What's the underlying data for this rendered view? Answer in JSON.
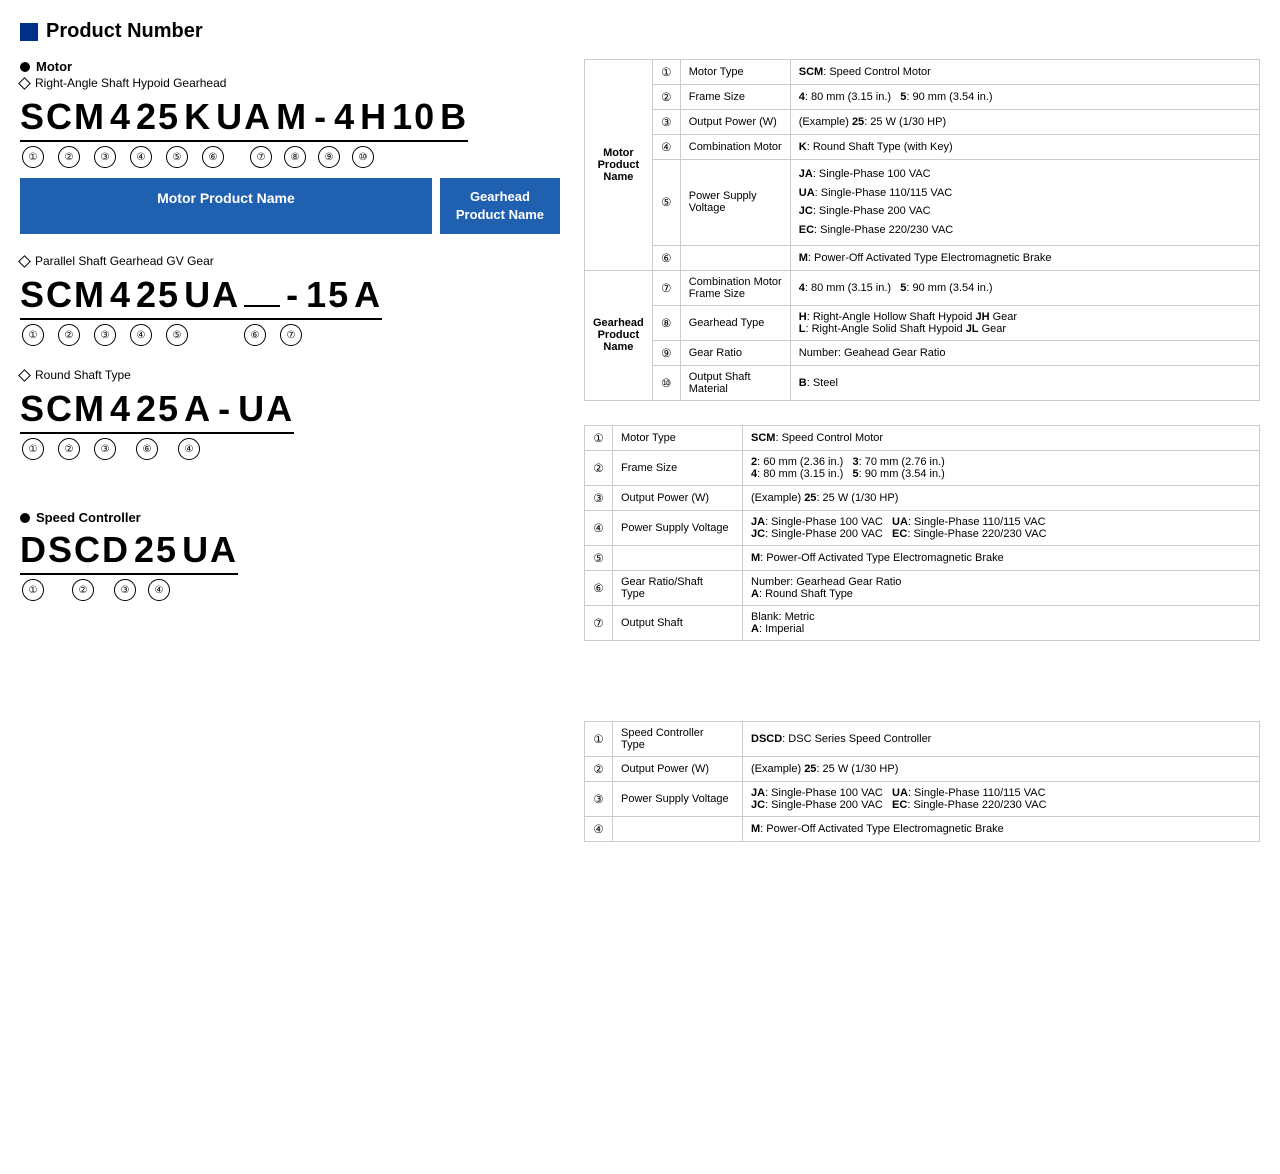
{
  "page": {
    "title": "Product Number",
    "sections": {
      "motor_label": "Motor",
      "right_angle_label": "Right-Angle Shaft Hypoid Gearhead",
      "parallel_label": "Parallel Shaft Gearhead GV Gear",
      "round_shaft_label": "Round Shaft Type",
      "speed_controller_label": "Speed Controller"
    },
    "codes": {
      "hypoid": "SCM 4 25 K UA M - 4 H 10 B",
      "parallel": "SCM 4 25 UA  - 15 A",
      "round_shaft": "SCM 4 25 A - UA"
    },
    "boxes": {
      "motor_product_name": "Motor Product Name",
      "gearhead_product_name": "Gearhead\nProduct Name"
    },
    "speed_controller": {
      "code": "DSCD 25 UA",
      "label1": "①",
      "label2": "②",
      "label3": "③",
      "label4": "④"
    }
  },
  "table1": {
    "group_motor": "Motor\nProduct\nName",
    "group_gearhead": "Gearhead\nProduct\nName",
    "rows": [
      {
        "num": "①",
        "label": "Motor Type",
        "desc": "SCM: Speed Control Motor",
        "bold_parts": [
          "SCM"
        ]
      },
      {
        "num": "②",
        "label": "Frame Size",
        "desc": "4: 80 mm (3.15 in.)    5: 90 mm (3.54 in.)",
        "bold_parts": [
          "4",
          "5"
        ]
      },
      {
        "num": "③",
        "label": "Output Power (W)",
        "desc": "(Example) 25: 25 W (1/30 HP)",
        "bold_parts": [
          "25"
        ]
      },
      {
        "num": "④",
        "label": "Combination Motor",
        "desc": "K: Round Shaft Type (with Key)",
        "bold_parts": [
          "K"
        ]
      },
      {
        "num": "⑤",
        "label": "Power Supply Voltage",
        "desc": "JA: Single-Phase 100 VAC\nUA: Single-Phase 110/115 VAC\nJC: Single-Phase 200 VAC\nEC: Single-Phase 220/230 VAC",
        "bold_parts": [
          "JA",
          "UA",
          "JC",
          "EC"
        ]
      },
      {
        "num": "⑥",
        "label": "",
        "desc": "M: Power-Off Activated Type Electromagnetic Brake",
        "bold_parts": [
          "M"
        ]
      },
      {
        "num": "⑦",
        "label": "Combination Motor\nFrame Size",
        "desc": "4: 80 mm (3.15 in.)    5: 90 mm (3.54 in.)",
        "bold_parts": [
          "4",
          "5"
        ]
      },
      {
        "num": "⑧",
        "label": "Gearhead Type",
        "desc": "H: Right-Angle Hollow Shaft Hypoid JH Gear\nL: Right-Angle Solid Shaft Hypoid JL Gear",
        "bold_parts": [
          "H",
          "JH",
          "L",
          "JL"
        ]
      },
      {
        "num": "⑨",
        "label": "Gear Ratio",
        "desc": "Number: Geahead Gear Ratio",
        "bold_parts": []
      },
      {
        "num": "⑩",
        "label": "Output Shaft Material",
        "desc": "B: Steel",
        "bold_parts": [
          "B"
        ]
      }
    ]
  },
  "table2": {
    "rows": [
      {
        "num": "①",
        "label": "Motor Type",
        "desc": "SCM: Speed Control Motor",
        "bold_parts": [
          "SCM"
        ]
      },
      {
        "num": "②",
        "label": "Frame Size",
        "desc": "2: 60 mm (2.36 in.)    3: 70 mm (2.76 in.)\n4: 80 mm (3.15 in.)    5: 90 mm (3.54 in.)",
        "bold_parts": [
          "2",
          "3",
          "4",
          "5"
        ]
      },
      {
        "num": "③",
        "label": "Output Power (W)",
        "desc": "(Example) 25: 25 W (1/30 HP)",
        "bold_parts": [
          "25"
        ]
      },
      {
        "num": "④",
        "label": "Power Supply Voltage",
        "desc": "JA: Single-Phase 100 VAC    UA: Single-Phase 110/115 VAC\nJC: Single-Phase 200 VAC    EC: Single-Phase 220/230 VAC",
        "bold_parts": [
          "JA",
          "UA",
          "JC",
          "EC"
        ]
      },
      {
        "num": "⑤",
        "label": "",
        "desc": "M: Power-Off Activated Type Electromagnetic Brake",
        "bold_parts": [
          "M"
        ]
      },
      {
        "num": "⑥",
        "label": "Gear Ratio/Shaft\nType",
        "desc": "Number: Gearhead Gear Ratio\nA: Round Shaft Type",
        "bold_parts": [
          "A"
        ]
      },
      {
        "num": "⑦",
        "label": "Output Shaft",
        "desc": "Blank: Metric\nA: Imperial",
        "bold_parts": [
          "A"
        ]
      }
    ]
  },
  "table3": {
    "rows": [
      {
        "num": "①",
        "label": "Speed Controller\nType",
        "desc": "DSCD: DSC Series Speed Controller",
        "bold_parts": [
          "DSCD"
        ]
      },
      {
        "num": "②",
        "label": "Output Power (W)",
        "desc": "(Example) 25: 25 W (1/30 HP)",
        "bold_parts": [
          "25"
        ]
      },
      {
        "num": "③",
        "label": "Power Supply Voltage",
        "desc": "JA: Single-Phase 100 VAC    UA: Single-Phase 110/115 VAC\nJC: Single-Phase 200 VAC    EC: Single-Phase 220/230 VAC",
        "bold_parts": [
          "JA",
          "UA",
          "JC",
          "EC"
        ]
      },
      {
        "num": "④",
        "label": "",
        "desc": "M: Power-Off Activated Type Electromagnetic Brake",
        "bold_parts": [
          "M"
        ]
      }
    ]
  }
}
